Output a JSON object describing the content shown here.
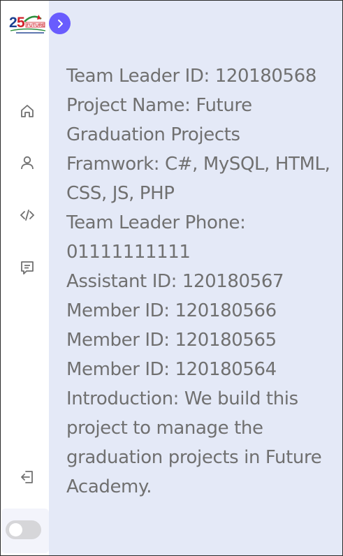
{
  "sidebar": {
    "logo": {
      "icon": "future-academy-25-logo",
      "text": "FUTURE"
    },
    "toggle_icon": "chevron-right-icon",
    "nav": [
      {
        "name": "home",
        "icon": "home-icon"
      },
      {
        "name": "profile",
        "icon": "user-icon"
      },
      {
        "name": "code",
        "icon": "code-icon"
      },
      {
        "name": "messages",
        "icon": "message-icon"
      }
    ],
    "logout_icon": "logout-icon",
    "dark_mode": {
      "on": false
    }
  },
  "project": {
    "team_leader_id": "Team Leader ID: 120180568",
    "project_name": "Project Name: Future Graduation Projects",
    "framework": "Framwork: C#, MySQL, HTML, CSS, JS, PHP",
    "team_leader_phone": "Team Leader Phone: 01111111111",
    "assistant_id": "Assistant ID: 120180567",
    "members": [
      "Member ID: 120180566",
      "Member ID: 120180565",
      "Member ID: 120180564"
    ],
    "introduction": "Introduction: We build this project to manage the graduation projects in Future Academy."
  }
}
